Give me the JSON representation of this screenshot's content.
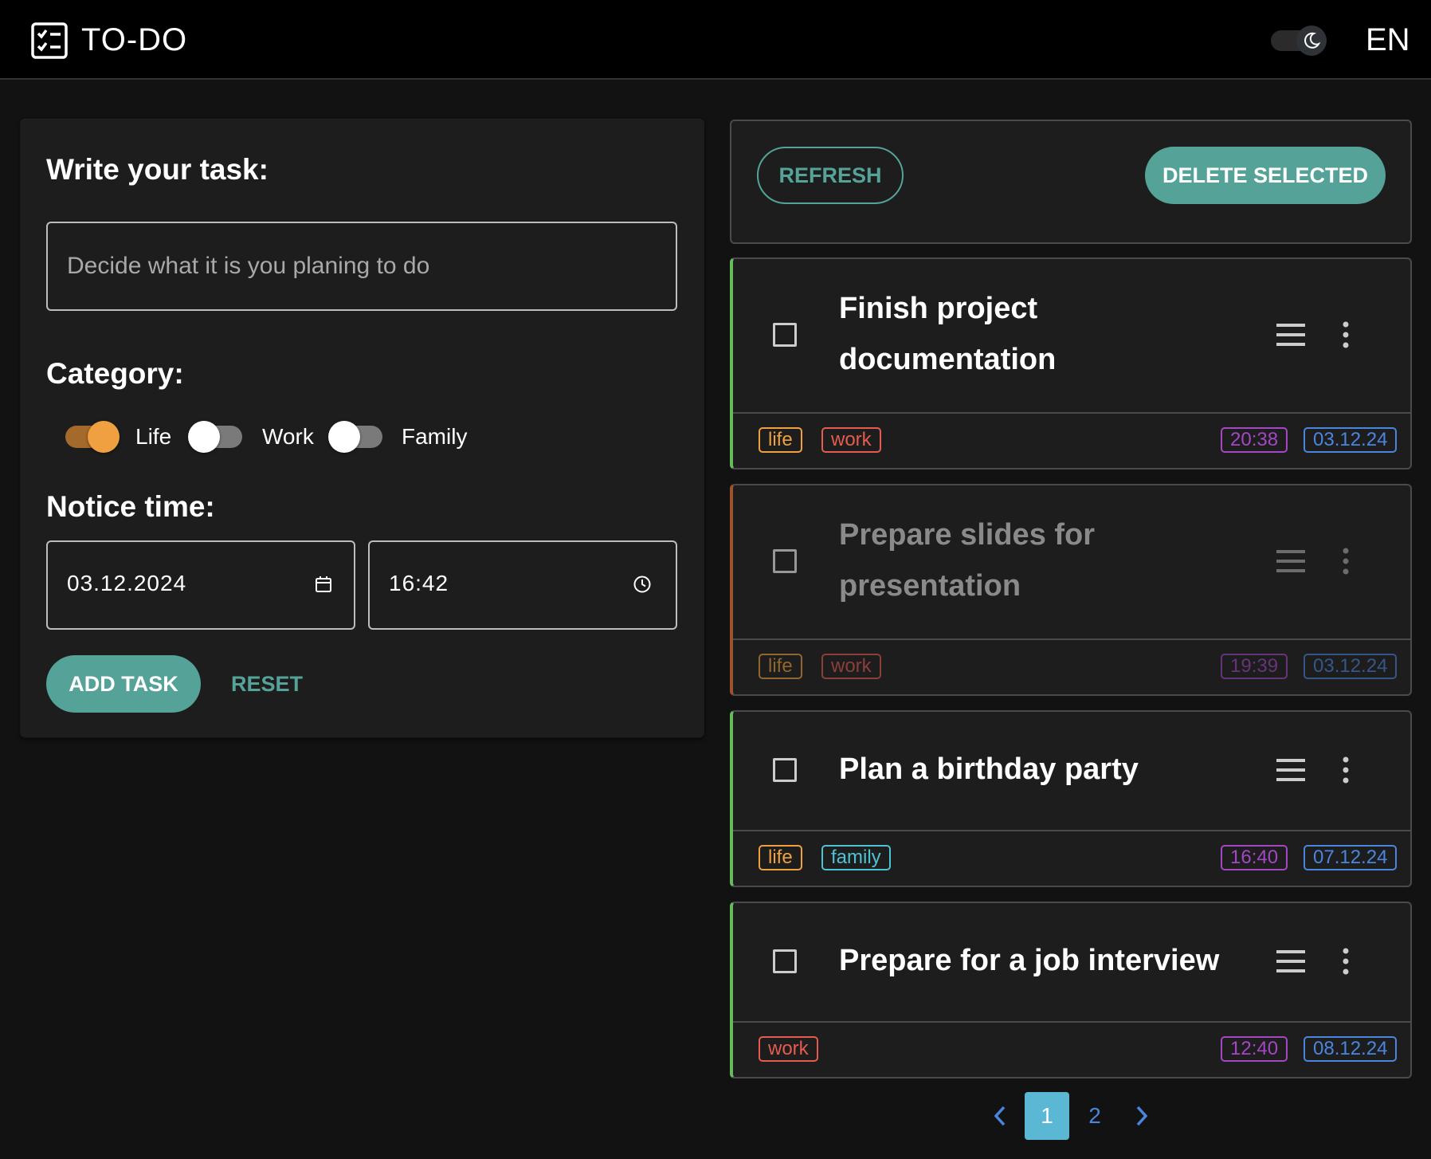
{
  "appbar": {
    "title": "TO-DO",
    "language": "EN",
    "logo_icon": "checklist-icon",
    "theme_icon": "moon-icon"
  },
  "form": {
    "task_label": "Write your task:",
    "task_placeholder": "Decide what it is you planing to do",
    "task_value": "",
    "category_label": "Category:",
    "categories": [
      {
        "label": "Life",
        "checked": true
      },
      {
        "label": "Work",
        "checked": false
      },
      {
        "label": "Family",
        "checked": false
      }
    ],
    "notice_label": "Notice time:",
    "date_value": "03.12.2024",
    "time_value": "16:42",
    "add_label": "ADD TASK",
    "reset_label": "RESET"
  },
  "toolbar": {
    "refresh_label": "REFRESH",
    "delete_label": "DELETE SELECTED"
  },
  "tasks": [
    {
      "title_line1": "Finish project",
      "title_line2": "documentation",
      "tags": [
        "life",
        "work"
      ],
      "time": "20:38",
      "date": "03.12.24",
      "expired": false
    },
    {
      "title_line1": "Prepare slides for",
      "title_line2": "presentation",
      "tags": [
        "life",
        "work"
      ],
      "time": "19:39",
      "date": "03.12.24",
      "expired": true
    },
    {
      "title_line1": "Plan a birthday party",
      "tags": [
        "life",
        "family"
      ],
      "time": "16:40",
      "date": "07.12.24",
      "expired": false
    },
    {
      "title_line1": "Prepare for a job interview",
      "tags": [
        "work"
      ],
      "time": "12:40",
      "date": "08.12.24",
      "expired": false
    }
  ],
  "pagination": {
    "pages": [
      "1",
      "2"
    ],
    "current": "1"
  },
  "colors": {
    "accent": "#55a398",
    "life": "#f0a040",
    "work": "#e65b4f",
    "family": "#4fc3d6",
    "time": "#a347c4",
    "date": "#4a86e0",
    "active_border": "#66bb5a",
    "expired_border": "#a0522d",
    "page_active": "#5bb8d4"
  }
}
